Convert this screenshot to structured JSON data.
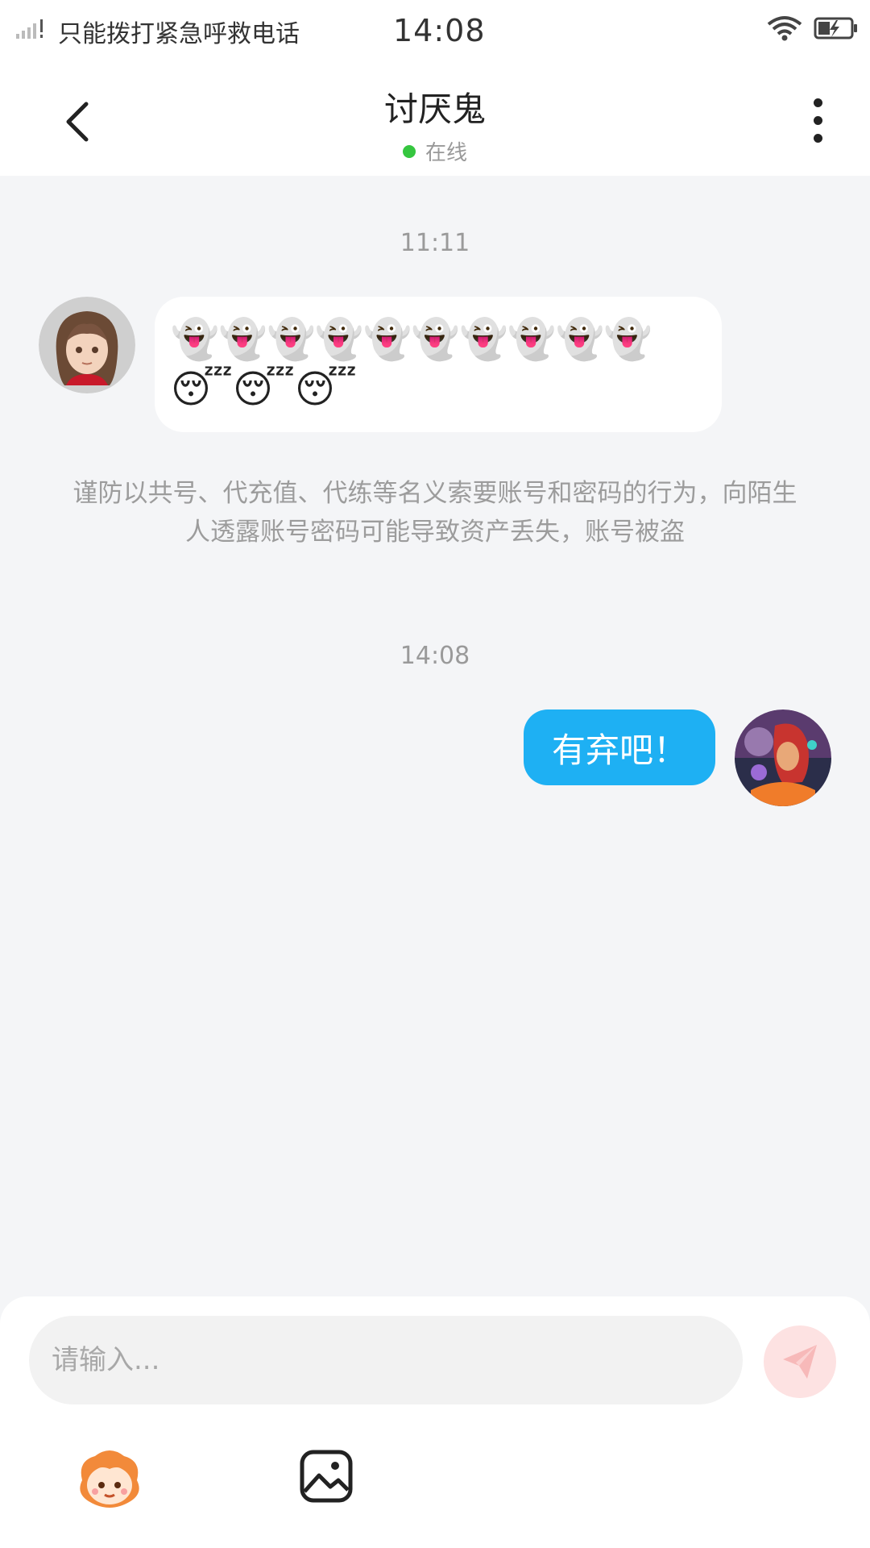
{
  "status_bar": {
    "carrier": "只能拨打紧急呼救电话",
    "time": "14:08"
  },
  "header": {
    "title": "讨厌鬼",
    "status": "在线"
  },
  "messages": {
    "time1": "11:11",
    "received_text": "👻👻👻👻👻👻👻👻👻👻😴😴😴",
    "notice": "谨防以共号、代充值、代练等名义索要账号和密码的行为，向陌生人透露账号密码可能导致资产丢失，账号被盗",
    "time2": "14:08",
    "sent_text": "有弃吧！"
  },
  "input": {
    "placeholder": "请输入..."
  },
  "colors": {
    "accent_blue": "#1eb0f3",
    "online_green": "#35c63f",
    "send_disabled": "#fde2e2",
    "background": "#f4f5f7"
  },
  "icons": [
    "back-arrow-icon",
    "more-vertical-icon",
    "send-icon",
    "emoji-mascot-icon",
    "image-icon",
    "wifi-icon",
    "battery-icon",
    "signal-icon"
  ]
}
